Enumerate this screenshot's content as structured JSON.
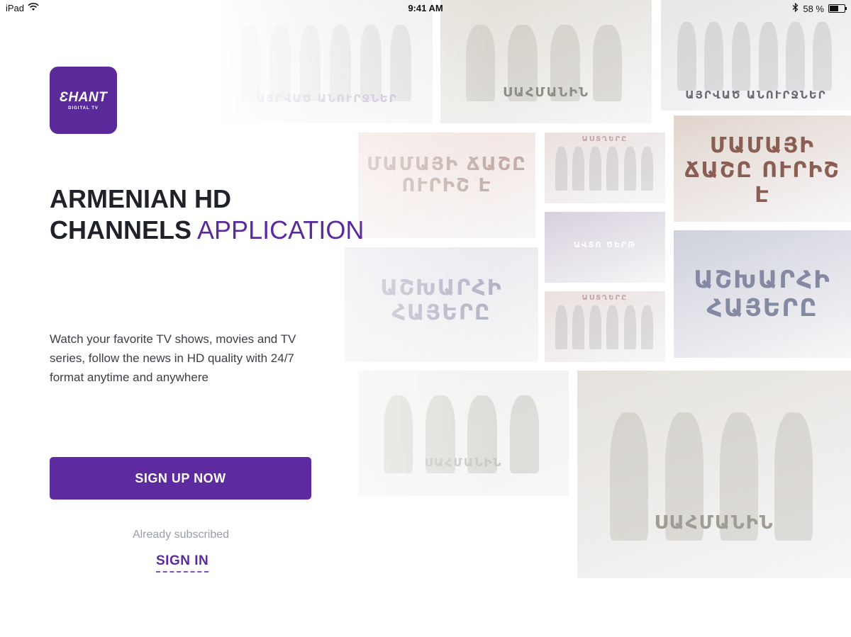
{
  "status_bar": {
    "device": "iPad",
    "time": "9:41 AM",
    "battery_text": "58 %",
    "battery_level": 0.58,
    "icons": [
      "wifi-icon",
      "bluetooth-icon",
      "battery-icon"
    ]
  },
  "logo": {
    "main_text": "ƐHANT",
    "sub_text": "DIGITAL TV"
  },
  "headline": {
    "line1": "ARMENIAN HD",
    "line2_bold": "CHANNELS",
    "line2_accent": "APPLICATION"
  },
  "description": "Watch your favorite TV shows, movies and TV series, follow the news in HD quality with 24/7 format anytime and anywhere",
  "signup_button": "SIGN UP NOW",
  "already_subscribed": "Already subscribed",
  "signin_link": "SIGN IN",
  "posters": [
    {
      "title": "ԱՅՐՎԱԾ ԱՆՈՒՐՋՆԵՐ"
    },
    {
      "title": "ՍԱՀՄԱՆԻՆ"
    },
    {
      "title": "ԱՅՐՎԱԾ ԱՆՈՒՐՋՆԵՐ"
    },
    {
      "title": "ՄԱՄԱՅԻ ՃԱՇԸ ՈՒՐԻՇ Է"
    },
    {
      "title": "ԱՍՏՂԵՐԸ"
    },
    {
      "title": "ՄԱՄԱՅԻ ՃԱՇԸ ՈՒՐԻՇ Է"
    },
    {
      "title": "ԱՎՏՈ ԾԵՐԹ"
    },
    {
      "title": "ԱՇԽԱՐՀԻ ՀԱՅԵՐԸ"
    },
    {
      "title": "ԱՍՏՂԵՐԸ"
    },
    {
      "title": "ԱՇԽԱՐՀԻ ՀԱՅԵՐԸ"
    },
    {
      "title": "ՍԱՀՄԱՆԻՆ"
    },
    {
      "title": "ՍԱՀՄԱՆԻՆ"
    }
  ],
  "colors": {
    "brand": "#5d2a9f",
    "accent_text": "#5b2b9e",
    "muted": "#9a9ea6"
  }
}
